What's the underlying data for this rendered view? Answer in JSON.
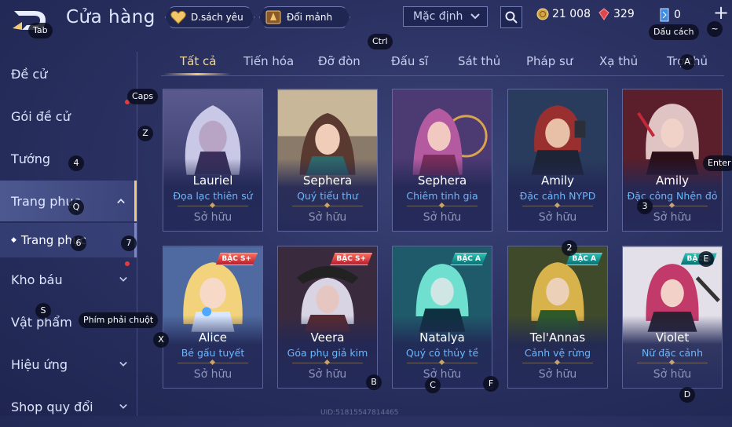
{
  "header": {
    "title": "Cửa hàng",
    "wishlist_label": "D.sách yêu",
    "exchange_label": "Đổi mảnh",
    "sort_value": "Mặc định",
    "currencies": {
      "gold": "21 008",
      "ruby": "329",
      "mark": "0"
    }
  },
  "hints": {
    "tab": "Tab",
    "ctrl": "Ctrl",
    "caps": "Caps",
    "z": "Z",
    "four": "4",
    "q": "Q",
    "six": "6",
    "seven": "7",
    "s": "S",
    "x": "X",
    "right_click": "Phím phải chuột",
    "a": "A",
    "enter": "Enter",
    "three": "3",
    "two": "2",
    "e": "E",
    "b": "B",
    "c": "C",
    "f": "F",
    "d": "D",
    "bookmark": "Dấu cách",
    "tilde": "~"
  },
  "sidebar": {
    "items": [
      {
        "label": "Đề cử"
      },
      {
        "label": "Gói đề cử"
      },
      {
        "label": "Tướng"
      },
      {
        "label": "Trang phục"
      },
      {
        "label": "Trang phục"
      },
      {
        "label": "Kho báu"
      },
      {
        "label": "Vật phẩm"
      },
      {
        "label": "Hiệu ứng"
      },
      {
        "label": "Shop quy đổi"
      }
    ]
  },
  "tabs": [
    "Tất cả",
    "Tiến hóa",
    "Đỡ đòn",
    "Đấu sĩ",
    "Sát thủ",
    "Pháp sư",
    "Xạ thủ",
    "Trợ thủ"
  ],
  "cards": [
    {
      "hero": "Lauriel",
      "skin": "Đọa lạc thiên sứ",
      "status": "Sở hữu",
      "badge": ""
    },
    {
      "hero": "Sephera",
      "skin": "Quý tiểu thư",
      "status": "Sở hữu",
      "badge": ""
    },
    {
      "hero": "Sephera",
      "skin": "Chiêm tinh gia",
      "status": "Sở hữu",
      "badge": ""
    },
    {
      "hero": "Amily",
      "skin": "Đặc cảnh NYPD",
      "status": "Sở hữu",
      "badge": ""
    },
    {
      "hero": "Amily",
      "skin": "Đặc công Nhện đỏ",
      "status": "Sở hữu",
      "badge": ""
    },
    {
      "hero": "Alice",
      "skin": "Bé gấu tuyết",
      "status": "Sở hữu",
      "badge": "BẬC S+"
    },
    {
      "hero": "Veera",
      "skin": "Góa phụ giả kim",
      "status": "Sở hữu",
      "badge": "BẬC S+"
    },
    {
      "hero": "Natalya",
      "skin": "Quý cô thủy tề",
      "status": "Sở hữu",
      "badge": "BẬC A"
    },
    {
      "hero": "Tel'Annas",
      "skin": "Cảnh vệ rừng",
      "status": "Sở hữu",
      "badge": "BẬC A"
    },
    {
      "hero": "Violet",
      "skin": "Nữ đặc cảnh",
      "status": "Sở hữu",
      "badge": "BẬC A"
    }
  ],
  "footer": {
    "uid": "UID:51815547814465"
  },
  "colors": {
    "accent_gold": "#f1c979",
    "skin_blue": "#68b8ff",
    "badge_red": "#d8323f",
    "badge_teal": "#1aa39a"
  }
}
